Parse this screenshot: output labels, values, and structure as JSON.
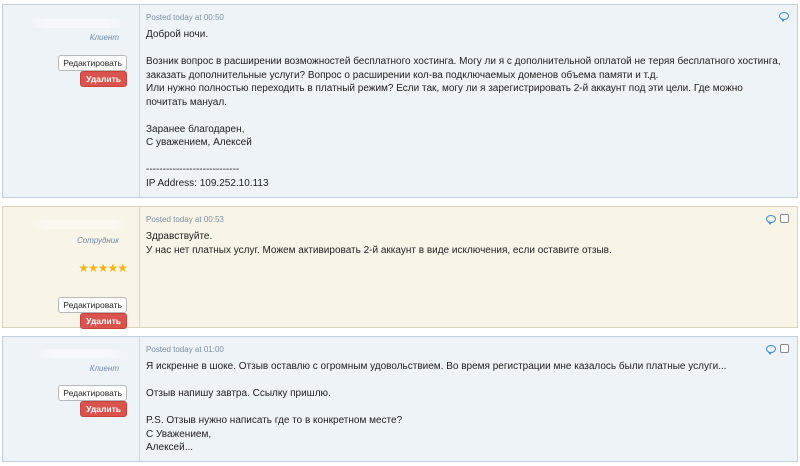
{
  "posts": [
    {
      "role": "Клиент",
      "edit_label": "Редактировать",
      "delete_label": "Удалить",
      "posted": "Posted today at 00:50",
      "lines": [
        "Доброй ночи.",
        "",
        "Возник вопрос в расширении возможностей бесплатного хостинга. Могу ли я с дополнительной оплатой не теряя бесплатного хостинга,",
        "заказать дополнительные услуги? Вопрос о расширении кол-ва подключаемых доменов объема памяти и т.д.",
        "Или нужно полностью переходить в платный режим? Если так, могу ли я зарегистрировать 2-й аккаунт под эти цели. Где можно",
        "почитать мануал.",
        "",
        "Заранее благодарен,",
        "С уважением, Алексей",
        "",
        "----------------------------",
        "IP Address: 109.252.10.113"
      ]
    },
    {
      "role": "Сотрудник",
      "stars": "★★★★★",
      "edit_label": "Редактировать",
      "delete_label": "Удалить",
      "posted": "Posted today at 00:53",
      "lines": [
        "Здравствуйте.",
        "У нас нет платных услуг. Можем активировать 2-й аккаунт в виде исключения, если оставите отзыв."
      ]
    },
    {
      "role": "Клиент",
      "edit_label": "Редактировать",
      "delete_label": "Удалить",
      "posted": "Posted today at 01:00",
      "lines": [
        "Я искренне в шоке. Отзыв оставлю с огромным удовольствием. Во время регистрации мне казалось были платные услуги...",
        "",
        "Отзыв напишу завтра. Ссылку пришлю.",
        "",
        "P.S. Отзыв нужно написать где то в конкретном месте?",
        "С Уважением,",
        "Алексей..."
      ]
    }
  ],
  "colors": {
    "client_bg": "#eef3f8",
    "staff_bg": "#f8f4e8",
    "delete_button": "#d9534f",
    "role_text": "#6f8aa8",
    "quote_icon": "#3a8fd0",
    "stars": "#f2b619"
  },
  "icons": [
    "quote-icon",
    "select-checkbox-icon",
    "star-icon"
  ]
}
